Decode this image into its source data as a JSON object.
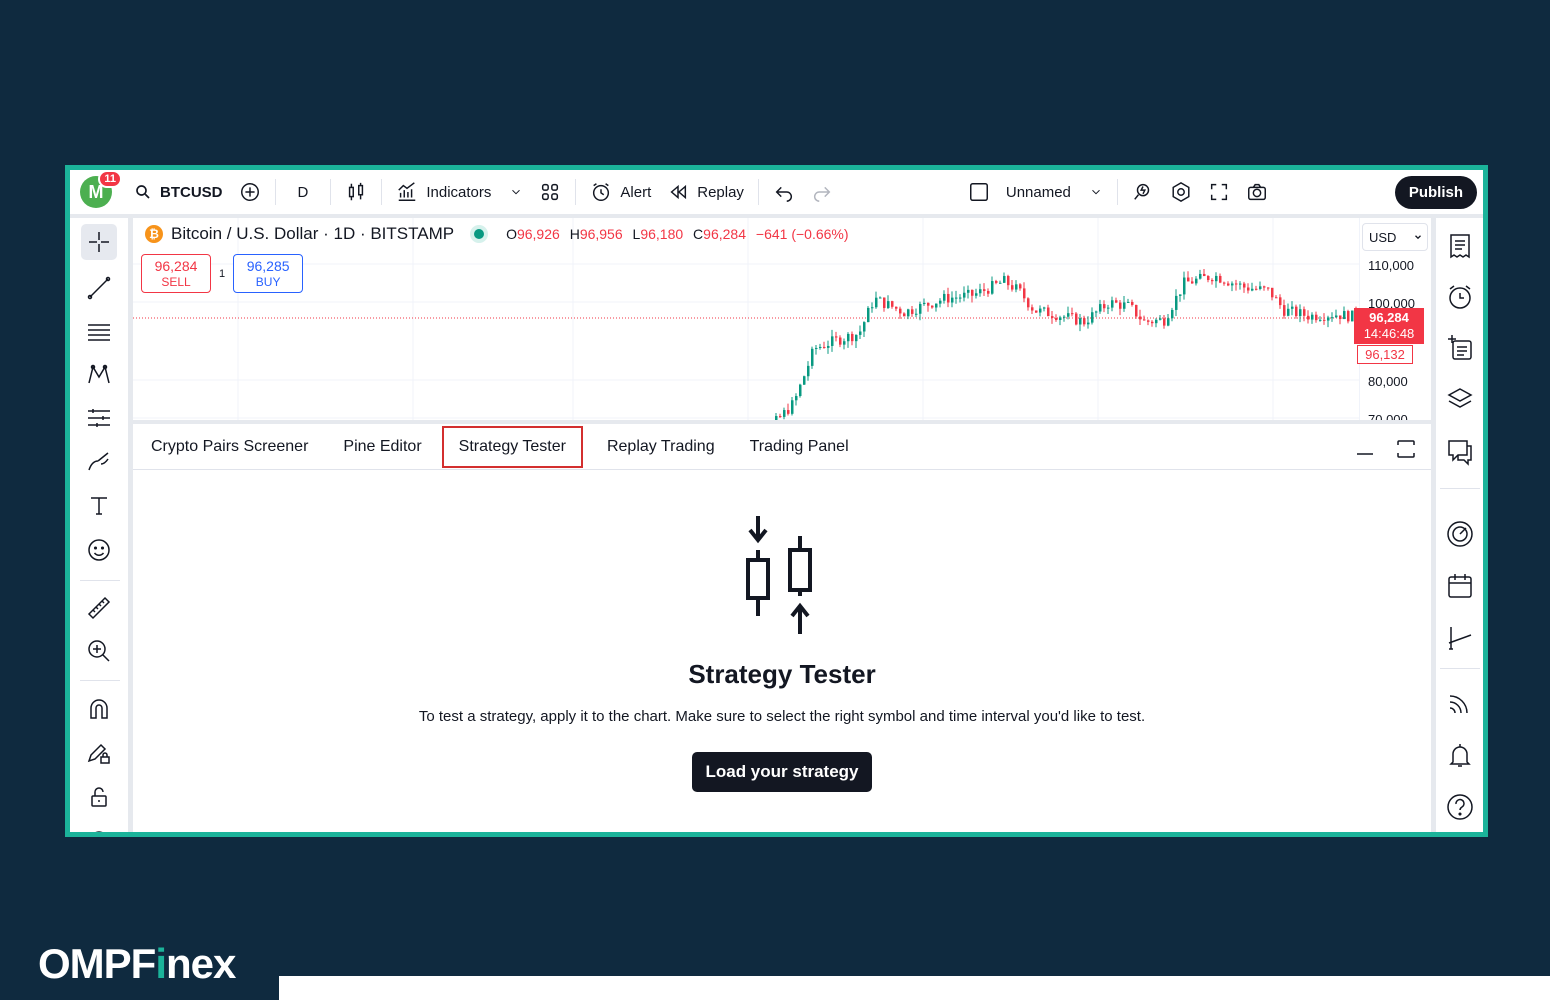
{
  "topbar": {
    "avatar_letter": "M",
    "notifications": "11",
    "symbol": "BTCUSD",
    "interval": "D",
    "indicators": "Indicators",
    "alert": "Alert",
    "replay": "Replay",
    "layout_name": "Unnamed",
    "publish": "Publish"
  },
  "chart": {
    "coin_letter": "₿",
    "title": "Bitcoin / U.S. Dollar · 1D · BITSTAMP",
    "ohlc": {
      "o_label": "O",
      "o": "96,926",
      "h_label": "H",
      "h": "96,956",
      "l_label": "L",
      "l": "96,180",
      "c_label": "C",
      "c": "96,284",
      "change": "−641 (−0.66%)"
    },
    "sell_price": "96,284",
    "sell_label": "SELL",
    "lot": "1",
    "buy_price": "96,285",
    "buy_label": "BUY",
    "currency": "USD",
    "ticks": [
      "110,000",
      "100,000",
      "80,000",
      "70,000"
    ],
    "last_price": "96,284",
    "countdown": "14:46:48",
    "second_price": "96,132",
    "up_color": "#089981",
    "down_color": "#f23645"
  },
  "panel": {
    "tabs": [
      "Crypto Pairs Screener",
      "Pine Editor",
      "Strategy Tester",
      "Replay Trading",
      "Trading Panel"
    ],
    "active_tab": "Strategy Tester",
    "title": "Strategy Tester",
    "description": "To test a strategy, apply it to the chart. Make sure to select the right symbol and time interval you'd like to test.",
    "button": "Load your strategy"
  },
  "brand": {
    "part1": "OMPF",
    "part2": "i",
    "part3": "nex"
  }
}
